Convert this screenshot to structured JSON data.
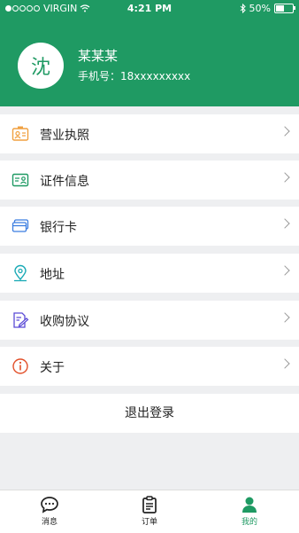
{
  "status_bar": {
    "carrier": "VIRGIN",
    "time": "4:21 PM",
    "battery": "50%"
  },
  "profile": {
    "avatar_char": "沈",
    "name": "某某某",
    "phone": "手机号：18xxxxxxxxx"
  },
  "menu": [
    {
      "label": "营业执照",
      "icon": "business-license-icon",
      "color": "#f0a040"
    },
    {
      "label": "证件信息",
      "icon": "id-card-icon",
      "color": "#1f9a63"
    },
    {
      "label": "银行卡",
      "icon": "bank-card-icon",
      "color": "#3b7de0"
    },
    {
      "label": "地址",
      "icon": "location-pin-icon",
      "color": "#18a9b5"
    },
    {
      "label": "收购协议",
      "icon": "agreement-icon",
      "color": "#5b4bd6"
    },
    {
      "label": "关于",
      "icon": "info-icon",
      "color": "#e2502a"
    }
  ],
  "logout_label": "退出登录",
  "tabs": [
    {
      "label": "消息",
      "icon": "message-icon"
    },
    {
      "label": "订单",
      "icon": "order-icon"
    },
    {
      "label": "我的",
      "icon": "person-icon",
      "active": true
    }
  ],
  "colors": {
    "brand": "#1f9a63"
  }
}
